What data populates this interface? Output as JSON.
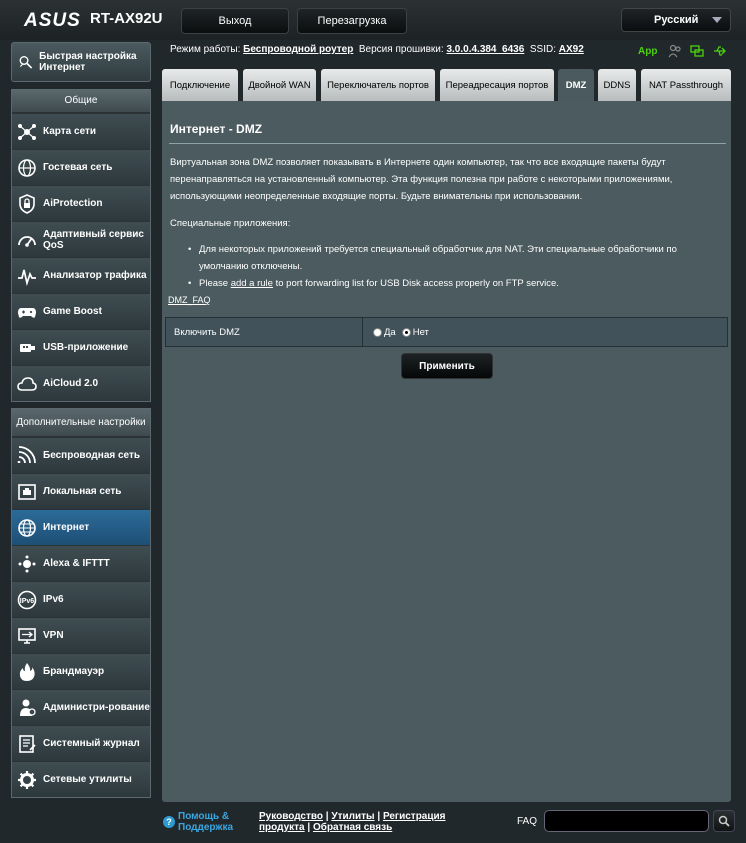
{
  "brand": {
    "logo": "ASUS",
    "model": "RT-AX92U"
  },
  "topbar": {
    "logout": "Выход",
    "reboot": "Перезагрузка",
    "language": "Русский"
  },
  "info": {
    "mode_label": "Режим работы:",
    "mode_value": "Беспроводной роутер",
    "fw_label": "Версия прошивки:",
    "fw_value": "3.0.0.4.384_6436",
    "ssid_label": "SSID:",
    "ssid_value": "AX92",
    "app_label": "App"
  },
  "sidebar": {
    "quick_setup": "Быстрая настройка Интернет",
    "general_header": "Общие",
    "general_items": [
      "Карта сети",
      "Гостевая сеть",
      "AiProtection",
      "Адаптивный сервис QoS",
      "Анализатор трафика",
      "Game Boost",
      "USB-приложение",
      "AiCloud 2.0"
    ],
    "advanced_header": "Дополнительные настройки",
    "advanced_items": [
      "Беспроводная сеть",
      "Локальная сеть",
      "Интернет",
      "Alexa & IFTTT",
      "IPv6",
      "VPN",
      "Брандмауэр",
      "Администри-рование",
      "Системный журнал",
      "Сетевые утилиты"
    ]
  },
  "tabs": [
    "Подключение",
    "Двойной WAN",
    "Переключатель портов",
    "Переадресация портов",
    "DMZ",
    "DDNS",
    "NAT Passthrough"
  ],
  "main": {
    "title": "Интернет - DMZ",
    "description": "Виртуальная зона DMZ позволяет показывать в Интернете один компьютер, так что все входящие пакеты будут перенаправляться на установленный компьютер. Эта функция полезна при работе с некоторыми приложениями, использующими неопределенные входящие порты. Будьте внимательны при использовании.",
    "special_label": "Специальные приложения:",
    "bullet1": "Для некоторых приложений требуется специальный обработчик для NAT. Эти специальные обработчики по умолчанию отключены.",
    "bullet2_pre": "Please ",
    "bullet2_link": "add a rule",
    "bullet2_post": " to port forwarding list for USB Disk access properly on FTP service.",
    "faq_link": "DMZ_FAQ",
    "enable_label": "Включить DMZ",
    "opt_yes": "Да",
    "opt_no": "Нет",
    "apply": "Применить"
  },
  "footer": {
    "help": "Помощь & Поддержка",
    "manual": "Руководство",
    "utilities": "Утилиты",
    "registration": "Регистрация продукта",
    "feedback": "Обратная связь",
    "faq": "FAQ",
    "faq_placeholder": ""
  }
}
